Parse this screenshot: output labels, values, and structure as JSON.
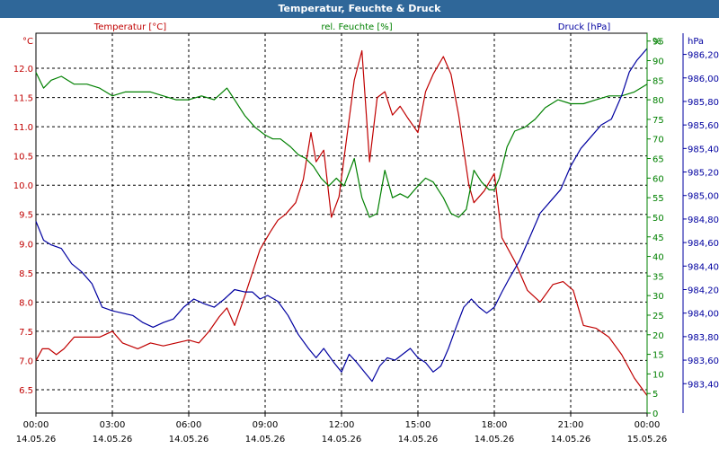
{
  "window": {
    "title": "Temperatur, Feuchte & Druck"
  },
  "chart_data": {
    "type": "line",
    "title": "Temperatur, Feuchte & Druck",
    "x": {
      "unit": "hours since 14.05.26 00:00 (axis shows time/date)",
      "range": [
        0,
        24
      ],
      "ticks": [
        {
          "h": 0,
          "time": "00:00",
          "date": "14.05.26"
        },
        {
          "h": 3,
          "time": "03:00",
          "date": "14.05.26"
        },
        {
          "h": 6,
          "time": "06:00",
          "date": "14.05.26"
        },
        {
          "h": 9,
          "time": "09:00",
          "date": "14.05.26"
        },
        {
          "h": 12,
          "time": "12:00",
          "date": "14.05.26"
        },
        {
          "h": 15,
          "time": "15:00",
          "date": "14.05.26"
        },
        {
          "h": 18,
          "time": "18:00",
          "date": "14.05.26"
        },
        {
          "h": 21,
          "time": "21:00",
          "date": "14.05.26"
        },
        {
          "h": 24,
          "time": "00:00",
          "date": "15.05.26"
        }
      ]
    },
    "grid": true,
    "axes": {
      "temp": {
        "unit_label": "°C",
        "range": [
          6.1,
          12.6
        ],
        "ticks": [
          "6.5",
          "7.0",
          "7.5",
          "8.0",
          "8.5",
          "9.0",
          "9.5",
          "10.0",
          "10.5",
          "11.0",
          "11.5",
          "12.0"
        ],
        "color": "#c00000"
      },
      "hum": {
        "unit_label": "%",
        "range": [
          0,
          97
        ],
        "ticks": [
          "0",
          "5",
          "10",
          "15",
          "20",
          "25",
          "30",
          "35",
          "40",
          "45",
          "50",
          "55",
          "60",
          "65",
          "70",
          "75",
          "80",
          "85",
          "90",
          "95"
        ],
        "color": "#008000"
      },
      "press": {
        "unit_label": "hPa",
        "range": [
          983.15,
          986.38
        ],
        "ticks": [
          "983,40",
          "983,60",
          "983,80",
          "984,00",
          "984,20",
          "984,40",
          "984,60",
          "984,80",
          "985,00",
          "985,20",
          "985,40",
          "985,60",
          "985,80",
          "986,00",
          "986,20"
        ],
        "color": "#0000a0"
      }
    },
    "series": [
      {
        "name": "Temperatur [°C]",
        "axis": "temp",
        "color": "#c00000",
        "x": [
          0,
          0.25,
          0.5,
          0.8,
          1.1,
          1.5,
          2,
          2.5,
          3,
          3.4,
          4,
          4.5,
          5,
          5.5,
          6,
          6.4,
          6.8,
          7.2,
          7.5,
          7.8,
          8.2,
          8.5,
          8.8,
          9.2,
          9.5,
          9.8,
          10.2,
          10.5,
          10.8,
          11,
          11.3,
          11.6,
          11.9,
          12.2,
          12.5,
          12.8,
          13.1,
          13.4,
          13.7,
          14,
          14.3,
          14.6,
          15,
          15.3,
          15.6,
          16,
          16.3,
          16.6,
          17,
          17.2,
          17.6,
          18,
          18.3,
          18.8,
          19.3,
          19.8,
          20.3,
          20.7,
          21.1,
          21.5,
          22,
          22.5,
          23,
          23.5,
          24
        ],
        "values": [
          7.0,
          7.2,
          7.2,
          7.1,
          7.2,
          7.4,
          7.4,
          7.4,
          7.5,
          7.3,
          7.2,
          7.3,
          7.25,
          7.3,
          7.35,
          7.3,
          7.5,
          7.75,
          7.9,
          7.6,
          8.1,
          8.5,
          8.9,
          9.2,
          9.4,
          9.5,
          9.7,
          10.1,
          10.9,
          10.4,
          10.6,
          9.45,
          9.8,
          10.8,
          11.8,
          12.3,
          10.4,
          11.5,
          11.6,
          11.2,
          11.35,
          11.15,
          10.9,
          11.6,
          11.9,
          12.2,
          11.9,
          11.2,
          10.0,
          9.7,
          9.9,
          10.2,
          9.1,
          8.7,
          8.2,
          8.0,
          8.3,
          8.35,
          8.2,
          7.6,
          7.55,
          7.4,
          7.1,
          6.7,
          6.4
        ]
      },
      {
        "name": "rel. Feuchte [%]",
        "axis": "hum",
        "color": "#008000",
        "x": [
          0,
          0.3,
          0.6,
          1,
          1.5,
          2,
          2.5,
          3,
          3.5,
          4,
          4.5,
          5,
          5.5,
          6,
          6.5,
          7,
          7.5,
          7.8,
          8.2,
          8.6,
          9,
          9.3,
          9.6,
          10,
          10.3,
          10.6,
          10.9,
          11.2,
          11.5,
          11.8,
          12.1,
          12.5,
          12.8,
          13.1,
          13.4,
          13.7,
          14,
          14.3,
          14.6,
          15,
          15.3,
          15.6,
          16,
          16.3,
          16.6,
          16.9,
          17.2,
          17.5,
          17.8,
          18,
          18.2,
          18.5,
          18.8,
          19.2,
          19.6,
          20,
          20.5,
          21,
          21.5,
          22,
          22.5,
          23,
          23.5,
          24
        ],
        "values": [
          87,
          83,
          85,
          86,
          84,
          84,
          83,
          81,
          82,
          82,
          82,
          81,
          80,
          80,
          81,
          80,
          83,
          80,
          76,
          73,
          71,
          70,
          70,
          68,
          66,
          65,
          63,
          60,
          58,
          60,
          58,
          65,
          55,
          50,
          51,
          62,
          55,
          56,
          55,
          58,
          60,
          59,
          55,
          51,
          50,
          52,
          62,
          59,
          57,
          57,
          60,
          68,
          72,
          73,
          75,
          78,
          80,
          79,
          79,
          80,
          81,
          81,
          82,
          84
        ]
      },
      {
        "name": "Druck [hPa]",
        "axis": "press",
        "color": "#0000a0",
        "x": [
          0,
          0.3,
          0.6,
          1,
          1.4,
          1.8,
          2.2,
          2.6,
          3,
          3.4,
          3.8,
          4.2,
          4.6,
          5,
          5.4,
          5.8,
          6.2,
          6.6,
          7,
          7.4,
          7.8,
          8.2,
          8.5,
          8.8,
          9.1,
          9.5,
          9.9,
          10.3,
          10.7,
          11,
          11.3,
          11.7,
          12,
          12.3,
          12.6,
          12.9,
          13.2,
          13.5,
          13.8,
          14.1,
          14.4,
          14.7,
          15,
          15.3,
          15.6,
          15.9,
          16.2,
          16.5,
          16.8,
          17.1,
          17.4,
          17.7,
          18,
          18.3,
          18.6,
          19,
          19.4,
          19.8,
          20.2,
          20.6,
          21,
          21.4,
          21.8,
          22.2,
          22.6,
          23,
          23.3,
          23.6,
          24
        ],
        "values": [
          984.78,
          984.62,
          984.58,
          984.55,
          984.42,
          984.35,
          984.25,
          984.05,
          984.02,
          984.0,
          983.98,
          983.92,
          983.88,
          983.92,
          983.95,
          984.05,
          984.12,
          984.08,
          984.05,
          984.12,
          984.2,
          984.18,
          984.18,
          984.12,
          984.15,
          984.1,
          983.98,
          983.82,
          983.7,
          983.62,
          983.7,
          983.58,
          983.5,
          983.65,
          983.58,
          983.5,
          983.42,
          983.55,
          983.62,
          983.6,
          983.65,
          983.7,
          983.62,
          983.58,
          983.5,
          983.55,
          983.7,
          983.88,
          984.05,
          984.12,
          984.05,
          984.0,
          984.05,
          984.18,
          984.3,
          984.45,
          984.65,
          984.85,
          984.95,
          985.05,
          985.25,
          985.4,
          985.5,
          985.6,
          985.65,
          985.85,
          986.05,
          986.15,
          986.25
        ]
      }
    ]
  }
}
